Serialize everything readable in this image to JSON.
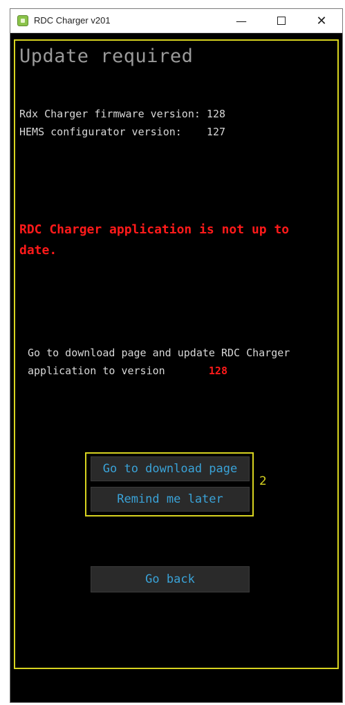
{
  "window": {
    "title": "RDC Charger v201",
    "controls": {
      "minimize": "—",
      "close": "✕"
    }
  },
  "page": {
    "heading": "Update required",
    "firmware_line": "Rdx Charger firmware version: 128",
    "hems_line": "HEMS configurator version:    127",
    "warning": "RDC Charger application is not up to date.",
    "note_line1": "Go to download page and update RDC Charger",
    "note_line2": "application to version",
    "target_version": "128"
  },
  "buttons": {
    "download": "Go to download page",
    "remind": "Remind me later",
    "back": "Go back"
  },
  "annotation": {
    "callout_number": "2"
  },
  "colors": {
    "highlight": "#d8d420",
    "warning": "#ff1a1a",
    "button_text": "#3aa3d8",
    "background": "#000000"
  }
}
